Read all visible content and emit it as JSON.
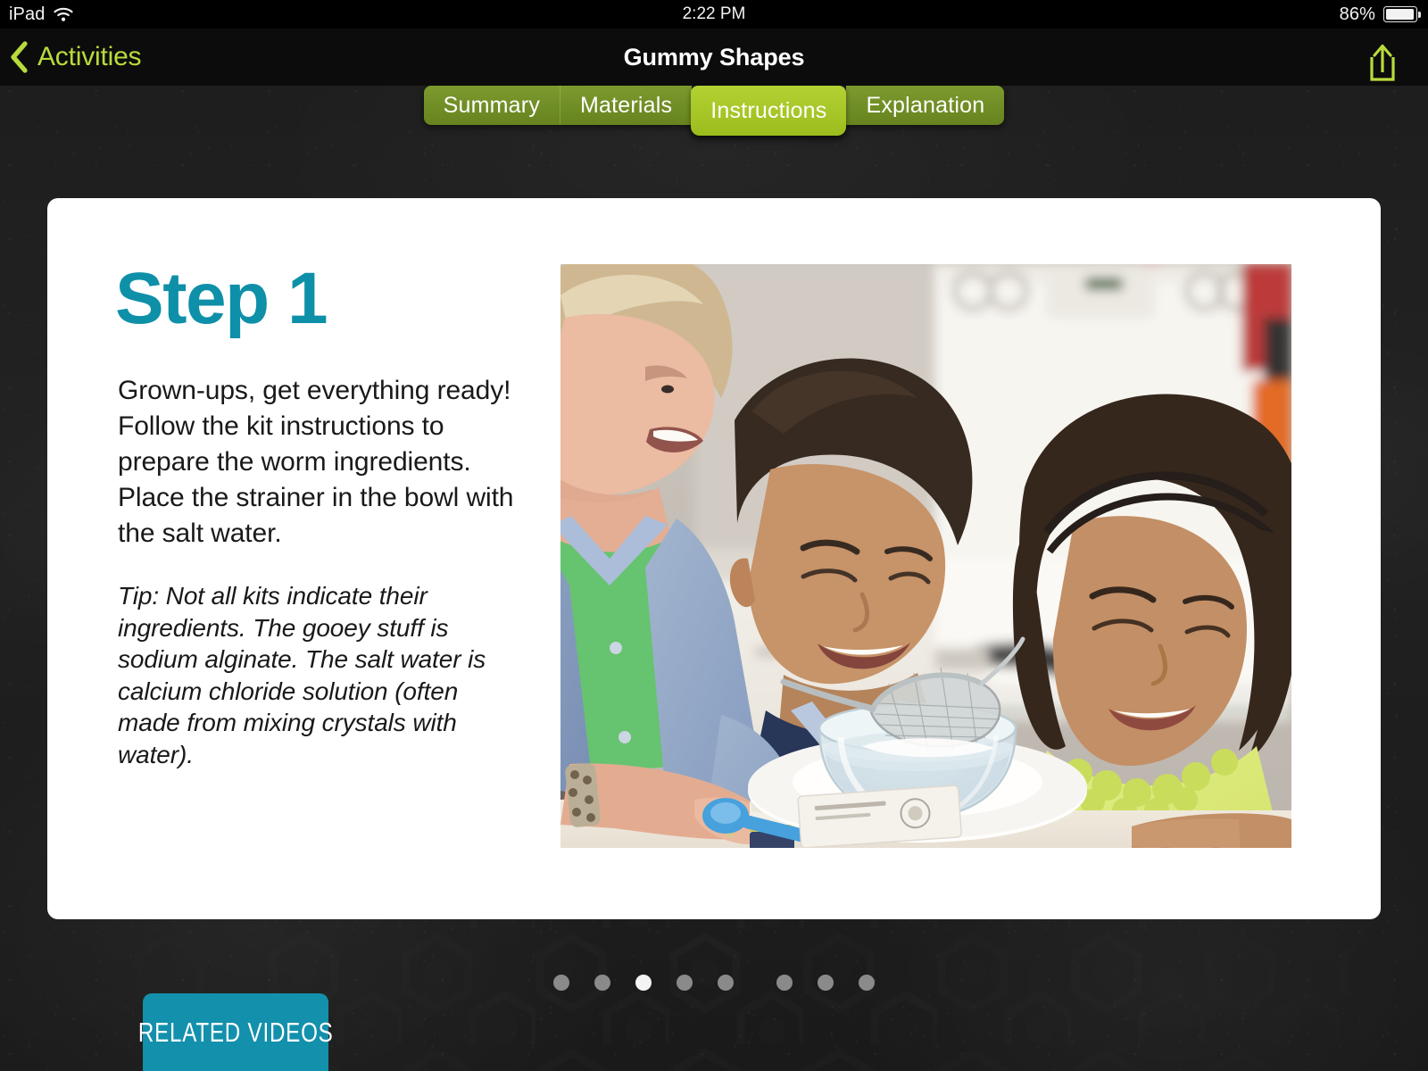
{
  "status_bar": {
    "device_label": "iPad",
    "wifi_icon": "wifi-icon",
    "time": "2:22 PM",
    "battery_percent": "86%",
    "battery_level": 86
  },
  "nav_bar": {
    "back_label": "Activities",
    "back_icon": "chevron-left-icon",
    "title": "Gummy Shapes",
    "share_icon": "share-icon",
    "back_color": "#b8db3c",
    "share_color": "#b8db3c"
  },
  "tabs": {
    "items": [
      {
        "label": "Summary",
        "active": false
      },
      {
        "label": "Materials",
        "active": false
      },
      {
        "label": "Instructions",
        "active": true
      },
      {
        "label": "Explanation",
        "active": false
      }
    ],
    "active_color": "#a5c422",
    "inactive_color": "#6d8b26"
  },
  "card": {
    "step_title": "Step 1",
    "step_title_color": "#0e90a8",
    "body": "Grown-ups, get everything ready! Follow the kit instructions to prepare the worm ingredients. Place the strainer in the bowl with the salt water.",
    "tip": "Tip: Not all kits indicate their ingredients. The gooey stuff is sodium alginate. The salt water is calcium chloride solution (often made from mixing crystals with water).",
    "photo_alt": "An adult and two children at a kitchen table placing a metal strainer into a glass bowl of salt water"
  },
  "pager": {
    "total": 8,
    "current": 3,
    "active_color": "#f4f4f4",
    "inactive_color": "#8a8a8a"
  },
  "related_videos": {
    "label": "RELATED VIDEOS",
    "color": "#1390ac"
  }
}
